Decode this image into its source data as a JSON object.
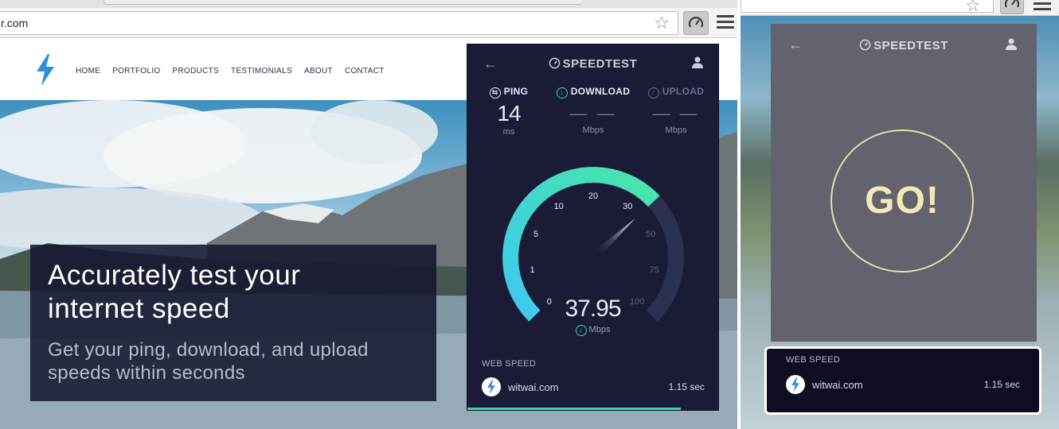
{
  "browser": {
    "url_fragment": "r.com",
    "star_icon": "star-icon",
    "extension_icon": "speedometer-icon",
    "menu_icon": "hamburger-menu-icon"
  },
  "website": {
    "logo_icon": "lightning-bolt-icon",
    "nav": [
      "HOME",
      "PORTFOLIO",
      "PRODUCTS",
      "TESTIMONIALS",
      "ABOUT",
      "CONTACT"
    ],
    "hero_title_line1": "Accurately test your",
    "hero_title_line2": "internet speed",
    "hero_sub_line1": "Get your ping, download, and upload",
    "hero_sub_line2": "speeds within seconds"
  },
  "speedtest_popup": {
    "brand": "SPEEDTEST",
    "back_icon": "back-arrow-icon",
    "user_icon": "user-icon",
    "ping": {
      "label": "PING",
      "value": "14",
      "unit": "ms"
    },
    "download": {
      "label": "DOWNLOAD",
      "value": "— —",
      "unit": "Mbps"
    },
    "upload": {
      "label": "UPLOAD",
      "value": "— —",
      "unit": "Mbps"
    },
    "gauge": {
      "ticks": [
        "0",
        "1",
        "5",
        "10",
        "20",
        "30",
        "50",
        "75",
        "100"
      ],
      "current_speed": 37.95,
      "current_label": "37.95",
      "unit": "Mbps",
      "max": 100
    },
    "web_speed": {
      "label": "WEB SPEED",
      "site": "witwai.com",
      "time": "1.15 sec",
      "progress": 0.85
    },
    "colors": {
      "background": "#1a1b37",
      "accent_teal": "#35d3b2",
      "accent_cyan": "#3ec8f0",
      "track": "#2b3050"
    }
  },
  "go_popup": {
    "brand": "SPEEDTEST",
    "go_label": "GO!",
    "web_speed": {
      "label": "WEB SPEED",
      "site": "witwai.com",
      "time": "1.15 sec"
    },
    "colors": {
      "background": "#63636f",
      "go_ring": "#e9dfa0"
    }
  }
}
